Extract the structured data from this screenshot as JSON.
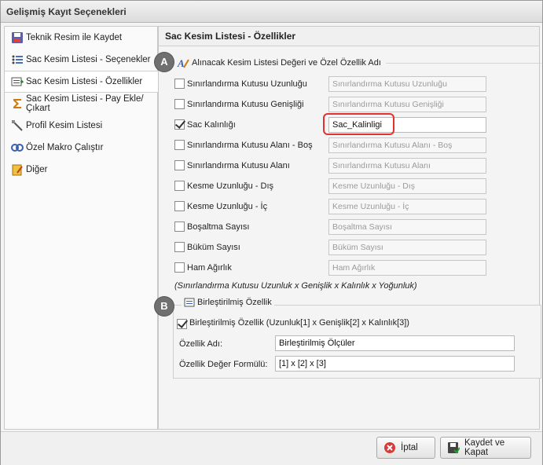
{
  "window": {
    "title": "Gelişmiş Kayıt Seçenekleri"
  },
  "sidebar": {
    "items": [
      {
        "label": "Teknik Resim ile Kaydet",
        "icon": "save-icon"
      },
      {
        "label": "Sac Kesim Listesi - Seçenekler",
        "icon": "list-options-icon"
      },
      {
        "label": "Sac Kesim Listesi - Özellikler",
        "icon": "list-properties-icon"
      },
      {
        "label": "Sac Kesim Listesi - Pay Ekle/Çıkart",
        "icon": "sigma-icon"
      },
      {
        "label": "Profil Kesim Listesi",
        "icon": "profile-icon"
      },
      {
        "label": "Özel Makro Çalıştır",
        "icon": "macro-icon"
      },
      {
        "label": "Diğer",
        "icon": "other-icon"
      }
    ],
    "active_index": 2
  },
  "content": {
    "title": "Sac Kesim Listesi - Özellikler",
    "group_a": {
      "badge": "A",
      "title": "Alınacak Kesim Listesi Değeri ve Özel Özellik Adı",
      "rows": [
        {
          "label": "Sınırlandırma Kutusu Uzunluğu",
          "value": "Sınırlandırma Kutusu Uzunluğu",
          "checked": false
        },
        {
          "label": "Sınırlandırma Kutusu Genişliği",
          "value": "Sınırlandırma Kutusu Genişliği",
          "checked": false
        },
        {
          "label": "Sac Kalınlığı",
          "value": "Sac_Kalinligi",
          "checked": true
        },
        {
          "label": "Sınırlandırma Kutusu Alanı - Boş",
          "value": "Sınırlandırma Kutusu Alanı - Boş",
          "checked": false
        },
        {
          "label": "Sınırlandırma Kutusu Alanı",
          "value": "Sınırlandırma Kutusu Alanı",
          "checked": false
        },
        {
          "label": "Kesme Uzunluğu - Dış",
          "value": "Kesme Uzunluğu - Dış",
          "checked": false
        },
        {
          "label": "Kesme Uzunluğu - İç",
          "value": "Kesme Uzunluğu - İç",
          "checked": false
        },
        {
          "label": "Boşaltma Sayısı",
          "value": "Boşaltma Sayısı",
          "checked": false
        },
        {
          "label": "Büküm Sayısı",
          "value": "Büküm Sayısı",
          "checked": false
        },
        {
          "label": "Ham Ağırlık",
          "value": "Ham Ağırlık",
          "checked": false
        }
      ],
      "note": "(Sınırlandırma Kutusu Uzunluk x Genişlik x Kalınlık x Yoğunluk)"
    },
    "group_b": {
      "badge": "B",
      "title": "Birleştirilmiş Özellik",
      "checkbox_label": "Birleştirilmiş Özellik (Uzunluk[1] x Genişlik[2] x Kalınlık[3])",
      "checked": true,
      "name_label": "Özellik Adı:",
      "name_value": "Birleştirilmiş Ölçüler",
      "formula_label": "Özellik Değer Formülü:",
      "formula_value": "[1] x [2] x [3]"
    }
  },
  "footer": {
    "cancel_label": "İptal",
    "save_close_label": "Kaydet ve Kapat"
  }
}
